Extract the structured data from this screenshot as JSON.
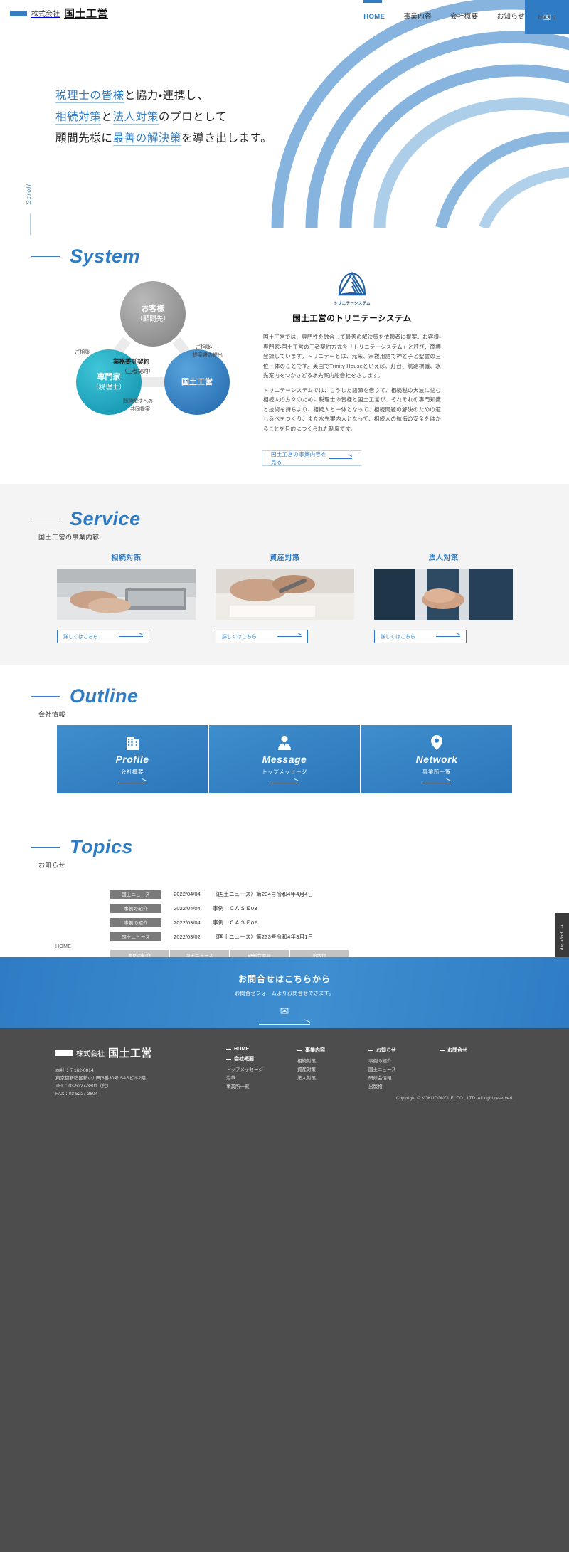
{
  "header": {
    "logo_small": "株式会社",
    "logo_big": "国土工営",
    "nav": [
      {
        "label": "HOME",
        "active": true
      },
      {
        "label": "事業内容",
        "active": false
      },
      {
        "label": "会社概要",
        "active": false
      },
      {
        "label": "お知らせ",
        "active": false
      }
    ],
    "contact": {
      "icon": "envelope-icon",
      "label": "お問合せ"
    }
  },
  "hero": {
    "lines": [
      [
        {
          "t": "税理士の皆様",
          "hl": true
        },
        {
          "t": "と協力・連携し、",
          "hl": false
        }
      ],
      [
        {
          "t": "相続対策",
          "hl": true
        },
        {
          "t": "と",
          "hl": false
        },
        {
          "t": "法人対策",
          "hl": true
        },
        {
          "t": "のプロとして",
          "hl": false
        }
      ],
      [
        {
          "t": "顧問先様に",
          "hl": false
        },
        {
          "t": "最善の解決策",
          "hl": true
        },
        {
          "t": "を導き出します。",
          "hl": false
        }
      ]
    ],
    "scroll_label": "Scroll"
  },
  "system": {
    "title": "System",
    "venn": {
      "customer": {
        "line1": "お客様",
        "line2": "（顧問先）"
      },
      "expert": {
        "line1": "専門家",
        "line2": "（税理士）"
      },
      "kokudo": {
        "line1": "国土工営"
      },
      "label_left": "ご相談",
      "label_right_1": "ご相談・",
      "label_right_2": "提案書の提出",
      "label_center_1": "業務委託契約",
      "label_center_2": "（三者契約）",
      "label_bottom_1": "問題解決への",
      "label_bottom_2": "共同提案"
    },
    "trinity_caption": "トリニテーシステム",
    "heading": "国土工営のトリニテーシステム",
    "paragraphs": [
      "国土工営では、専門性を融合して最善の解決策を依頼者に提案。お客様・専門家・国土工営の三者契約方式を「トリニテーシステム」と呼び、商標登録しています。トリニテーとは、元来、宗教用語で神と子と聖霊の三位一体のことです。英国でTrinity Houseといえば、灯台、航路標識、水先案内をつかさどる水先案内船会社をさします。",
      "トリニテーシステムでは、こうした語源を借りて、相続税の大波に悩む相続人の方々のために税理士の皆様と国土工営が、それぞれの専門知識と技術を持ちより、相続人と一体となって、相続問題の解決のための道しるべをつくり、また水先案内人となって、相続人の航海の安全をはかることを目的につくられた制度です。"
    ],
    "cta_label": "国土工営の事業内容を見る"
  },
  "service": {
    "title": "Service",
    "subtitle": "国土工営の事業内容",
    "cards": [
      {
        "title": "相続対策",
        "image": "hands-on-laptop-photo",
        "button": "詳しくはこちら"
      },
      {
        "title": "資産対策",
        "image": "hand-signing-document-photo",
        "button": "詳しくはこちら"
      },
      {
        "title": "法人対策",
        "image": "business-handshake-photo",
        "button": "詳しくはこちら"
      }
    ]
  },
  "outline": {
    "title": "Outline",
    "subtitle": "会社情報",
    "cards": [
      {
        "icon": "building-icon",
        "en": "Profile",
        "ja": "会社概要"
      },
      {
        "icon": "person-tie-icon",
        "en": "Message",
        "ja": "トップメッセージ"
      },
      {
        "icon": "map-pin-icon",
        "en": "Network",
        "ja": "事業所一覧"
      }
    ]
  },
  "topics": {
    "title": "Topics",
    "subtitle": "お知らせ",
    "items": [
      {
        "category": "国土ニュース",
        "date": "2022/04/04",
        "title": "《国土ニュース》第234号令和4年4月4日"
      },
      {
        "category": "事例の紹介",
        "date": "2022/04/04",
        "title": "事例　ＣＡＳＥ03"
      },
      {
        "category": "事例の紹介",
        "date": "2022/03/04",
        "title": "事例　ＣＡＳＥ02"
      },
      {
        "category": "国土ニュース",
        "date": "2022/03/02",
        "title": "《国土ニュース》第233号令和4年3月1日"
      }
    ],
    "tabs": [
      "事例の紹介",
      "国土ニュース",
      "研修会情報",
      "出版物"
    ]
  },
  "breadcrumb": "HOME",
  "pagetop": {
    "arrow": "↑",
    "label": "page top"
  },
  "cta": {
    "heading": "お問合せはこちらから",
    "sub": "お問合せフォームよりお問合せできます。",
    "icon": "envelope-icon"
  },
  "footer": {
    "logo_small": "株式会社",
    "logo_big": "国土工営",
    "address": [
      "本社：〒162-0814",
      "東京都新宿区新小川町6番30号 S&Sビル2階",
      "TEL：03-5227-3601（代）",
      "FAX：03-5227-3604"
    ],
    "columns": [
      {
        "head": "HOME",
        "dash": true,
        "links": [
          "会社概要",
          "トップメッセージ",
          "沿革",
          "事業所一覧"
        ],
        "head2": "会社概要"
      },
      {
        "head": "事業内容",
        "links": [
          "相続対策",
          "資産対策",
          "法人対策"
        ]
      },
      {
        "head": "お知らせ",
        "links": [
          "事例の紹介",
          "国土ニュース",
          "研修会情報",
          "出版物"
        ]
      },
      {
        "head": "お問合せ",
        "links": []
      }
    ],
    "copyright": "Copyright © KOKUDOKOUEI CO., LTD. All right reserved."
  },
  "colors": {
    "brand_blue": "#2f7cc4",
    "deep_blue": "#1e5fa8",
    "teal": "#1899b4",
    "gray": "#8e8e8e",
    "footer_bg": "#4d4d4d"
  }
}
